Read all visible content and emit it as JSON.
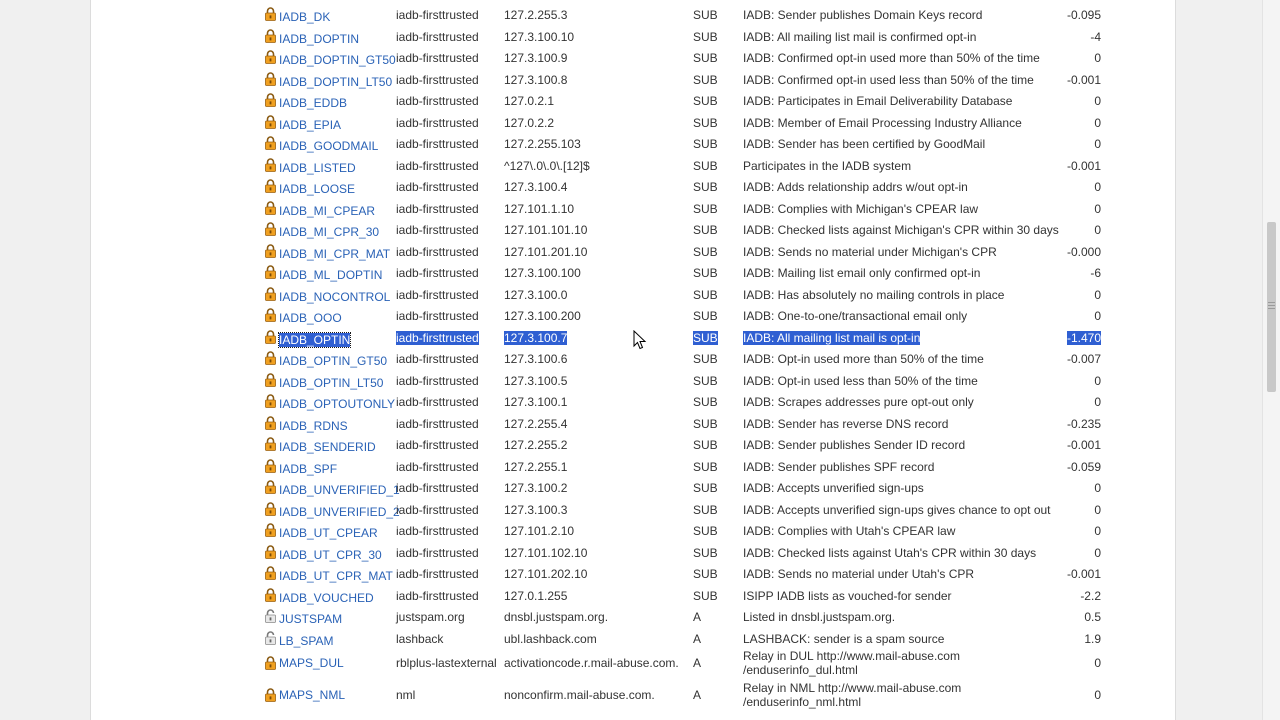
{
  "rules": [
    {
      "name": "IADB_DK",
      "source": "iadb-firsttrusted",
      "value": "127.2.255.3",
      "type": "SUB",
      "description": "IADB: Sender publishes Domain Keys record",
      "score": "-0.095",
      "icon": "lock-icon"
    },
    {
      "name": "IADB_DOPTIN",
      "source": "iadb-firsttrusted",
      "value": "127.3.100.10",
      "type": "SUB",
      "description": "IADB: All mailing list mail is confirmed opt-in",
      "score": "-4",
      "icon": "lock-icon"
    },
    {
      "name": "IADB_DOPTIN_GT50",
      "source": "iadb-firsttrusted",
      "value": "127.3.100.9",
      "type": "SUB",
      "description": "IADB: Confirmed opt-in used more than 50% of the time",
      "score": "0",
      "icon": "lock-icon"
    },
    {
      "name": "IADB_DOPTIN_LT50",
      "source": "iadb-firsttrusted",
      "value": "127.3.100.8",
      "type": "SUB",
      "description": "IADB: Confirmed opt-in used less than 50% of the time",
      "score": "-0.001",
      "icon": "lock-icon"
    },
    {
      "name": "IADB_EDDB",
      "source": "iadb-firsttrusted",
      "value": "127.0.2.1",
      "type": "SUB",
      "description": "IADB: Participates in Email Deliverability Database",
      "score": "0",
      "icon": "lock-icon"
    },
    {
      "name": "IADB_EPIA",
      "source": "iadb-firsttrusted",
      "value": "127.0.2.2",
      "type": "SUB",
      "description": "IADB: Member of Email Processing Industry Alliance",
      "score": "0",
      "icon": "lock-icon"
    },
    {
      "name": "IADB_GOODMAIL",
      "source": "iadb-firsttrusted",
      "value": "127.2.255.103",
      "type": "SUB",
      "description": "IADB: Sender has been certified by GoodMail",
      "score": "0",
      "icon": "lock-icon"
    },
    {
      "name": "IADB_LISTED",
      "source": "iadb-firsttrusted",
      "value": "^127\\.0\\.0\\.[12]$",
      "type": "SUB",
      "description": "Participates in the IADB system",
      "score": "-0.001",
      "icon": "lock-icon"
    },
    {
      "name": "IADB_LOOSE",
      "source": "iadb-firsttrusted",
      "value": "127.3.100.4",
      "type": "SUB",
      "description": "IADB: Adds relationship addrs w/out opt-in",
      "score": "0",
      "icon": "lock-icon"
    },
    {
      "name": "IADB_MI_CPEAR",
      "source": "iadb-firsttrusted",
      "value": "127.101.1.10",
      "type": "SUB",
      "description": "IADB: Complies with Michigan's CPEAR law",
      "score": "0",
      "icon": "lock-icon"
    },
    {
      "name": "IADB_MI_CPR_30",
      "source": "iadb-firsttrusted",
      "value": "127.101.101.10",
      "type": "SUB",
      "description": "IADB: Checked lists against Michigan's CPR within 30 days",
      "score": "0",
      "icon": "lock-icon"
    },
    {
      "name": "IADB_MI_CPR_MAT",
      "source": "iadb-firsttrusted",
      "value": "127.101.201.10",
      "type": "SUB",
      "description": "IADB: Sends no material under Michigan's CPR",
      "score": "-0.000",
      "icon": "lock-icon"
    },
    {
      "name": "IADB_ML_DOPTIN",
      "source": "iadb-firsttrusted",
      "value": "127.3.100.100",
      "type": "SUB",
      "description": "IADB: Mailing list email only confirmed opt-in",
      "score": "-6",
      "icon": "lock-icon"
    },
    {
      "name": "IADB_NOCONTROL",
      "source": "iadb-firsttrusted",
      "value": "127.3.100.0",
      "type": "SUB",
      "description": "IADB: Has absolutely no mailing controls in place",
      "score": "0",
      "icon": "lock-icon"
    },
    {
      "name": "IADB_OOO",
      "source": "iadb-firsttrusted",
      "value": "127.3.100.200",
      "type": "SUB",
      "description": "IADB: One-to-one/transactional email only",
      "score": "0",
      "icon": "lock-icon"
    },
    {
      "name": "IADB_OPTIN",
      "source": "iadb-firsttrusted",
      "value": "127.3.100.7",
      "type": "SUB",
      "description": "IADB: All mailing list mail is opt-in",
      "score": "-1.470",
      "icon": "lock-icon",
      "selected": true
    },
    {
      "name": "IADB_OPTIN_GT50",
      "source": "iadb-firsttrusted",
      "value": "127.3.100.6",
      "type": "SUB",
      "description": "IADB: Opt-in used more than 50% of the time",
      "score": "-0.007",
      "icon": "lock-icon"
    },
    {
      "name": "IADB_OPTIN_LT50",
      "source": "iadb-firsttrusted",
      "value": "127.3.100.5",
      "type": "SUB",
      "description": "IADB: Opt-in used less than 50% of the time",
      "score": "0",
      "icon": "lock-icon"
    },
    {
      "name": "IADB_OPTOUTONLY",
      "source": "iadb-firsttrusted",
      "value": "127.3.100.1",
      "type": "SUB",
      "description": "IADB: Scrapes addresses pure opt-out only",
      "score": "0",
      "icon": "lock-icon"
    },
    {
      "name": "IADB_RDNS",
      "source": "iadb-firsttrusted",
      "value": "127.2.255.4",
      "type": "SUB",
      "description": "IADB: Sender has reverse DNS record",
      "score": "-0.235",
      "icon": "lock-icon"
    },
    {
      "name": "IADB_SENDERID",
      "source": "iadb-firsttrusted",
      "value": "127.2.255.2",
      "type": "SUB",
      "description": "IADB: Sender publishes Sender ID record",
      "score": "-0.001",
      "icon": "lock-icon"
    },
    {
      "name": "IADB_SPF",
      "source": "iadb-firsttrusted",
      "value": "127.2.255.1",
      "type": "SUB",
      "description": "IADB: Sender publishes SPF record",
      "score": "-0.059",
      "icon": "lock-icon"
    },
    {
      "name": "IADB_UNVERIFIED_1",
      "source": "iadb-firsttrusted",
      "value": "127.3.100.2",
      "type": "SUB",
      "description": "IADB: Accepts unverified sign-ups",
      "score": "0",
      "icon": "lock-icon"
    },
    {
      "name": "IADB_UNVERIFIED_2",
      "source": "iadb-firsttrusted",
      "value": "127.3.100.3",
      "type": "SUB",
      "description": "IADB: Accepts unverified sign-ups gives chance to opt out",
      "score": "0",
      "icon": "lock-icon"
    },
    {
      "name": "IADB_UT_CPEAR",
      "source": "iadb-firsttrusted",
      "value": "127.101.2.10",
      "type": "SUB",
      "description": "IADB: Complies with Utah's CPEAR law",
      "score": "0",
      "icon": "lock-icon"
    },
    {
      "name": "IADB_UT_CPR_30",
      "source": "iadb-firsttrusted",
      "value": "127.101.102.10",
      "type": "SUB",
      "description": "IADB: Checked lists against Utah's CPR within 30 days",
      "score": "0",
      "icon": "lock-icon"
    },
    {
      "name": "IADB_UT_CPR_MAT",
      "source": "iadb-firsttrusted",
      "value": "127.101.202.10",
      "type": "SUB",
      "description": "IADB: Sends no material under Utah's CPR",
      "score": "-0.001",
      "icon": "lock-icon"
    },
    {
      "name": "IADB_VOUCHED",
      "source": "iadb-firsttrusted",
      "value": "127.0.1.255",
      "type": "SUB",
      "description": "ISIPP IADB lists as vouched-for sender",
      "score": "-2.2",
      "icon": "lock-icon"
    },
    {
      "name": "JUSTSPAM",
      "source": "justspam.org",
      "value": "dnsbl.justspam.org.",
      "type": "A",
      "description": "Listed in dnsbl.justspam.org.",
      "score": "0.5",
      "icon": "unlock-icon"
    },
    {
      "name": "LB_SPAM",
      "source": "lashback",
      "value": "ubl.lashback.com",
      "type": "A",
      "description": "LASHBACK: sender is a spam source",
      "score": "1.9",
      "icon": "unlock-icon"
    },
    {
      "name": "MAPS_DUL",
      "source": "rblplus-lastexternal",
      "value": "activationcode.r.mail-abuse.com.",
      "type": "A",
      "description": "Relay in DUL http://www.mail-abuse.com /enduserinfo_dul.html",
      "score": "0",
      "icon": "lock-icon",
      "tall": true
    },
    {
      "name": "MAPS_NML",
      "source": "nml",
      "value": "nonconfirm.mail-abuse.com.",
      "type": "A",
      "description": "Relay in NML http://www.mail-abuse.com /enduserinfo_nml.html",
      "score": "0",
      "icon": "lock-icon",
      "tall": true
    }
  ]
}
